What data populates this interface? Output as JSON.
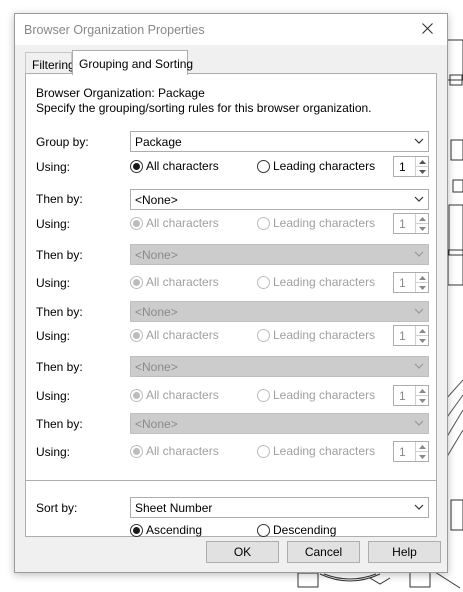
{
  "dialog": {
    "title": "Browser Organization Properties"
  },
  "tabs": [
    {
      "label": "Filtering",
      "active": false
    },
    {
      "label": "Grouping and Sorting",
      "active": true
    }
  ],
  "header": {
    "line1": "Browser Organization: Package",
    "line2": "Specify the grouping/sorting rules for this browser organization."
  },
  "rows": [
    {
      "group_label": "Group by:",
      "value": "Package",
      "enabled": true,
      "using_label": "Using:",
      "all_label": "All characters",
      "leading_label": "Leading characters",
      "all_selected": true,
      "count": "1"
    },
    {
      "group_label": "Then by:",
      "value": "<None>",
      "enabled": true,
      "using_label": "Using:",
      "all_label": "All characters",
      "leading_label": "Leading characters",
      "all_selected": true,
      "count": "1"
    },
    {
      "group_label": "Then by:",
      "value": "<None>",
      "enabled": false,
      "using_label": "Using:",
      "all_label": "All characters",
      "leading_label": "Leading characters",
      "all_selected": true,
      "count": "1"
    },
    {
      "group_label": "Then by:",
      "value": "<None>",
      "enabled": false,
      "using_label": "Using:",
      "all_label": "All characters",
      "leading_label": "Leading characters",
      "all_selected": true,
      "count": "1"
    },
    {
      "group_label": "Then by:",
      "value": "<None>",
      "enabled": false,
      "using_label": "Using:",
      "all_label": "All characters",
      "leading_label": "Leading characters",
      "all_selected": true,
      "count": "1"
    },
    {
      "group_label": "Then by:",
      "value": "<None>",
      "enabled": false,
      "using_label": "Using:",
      "all_label": "All characters",
      "leading_label": "Leading characters",
      "all_selected": true,
      "count": "1"
    }
  ],
  "sort": {
    "label": "Sort by:",
    "value": "Sheet Number",
    "ascending_label": "Ascending",
    "descending_label": "Descending",
    "ascending_selected": true
  },
  "buttons": {
    "ok": "OK",
    "cancel": "Cancel",
    "help": "Help"
  },
  "icons": {
    "close": "close-icon",
    "dropdown": "chevron-down-icon",
    "spin_up": "spin-up-icon",
    "spin_down": "spin-down-icon"
  }
}
